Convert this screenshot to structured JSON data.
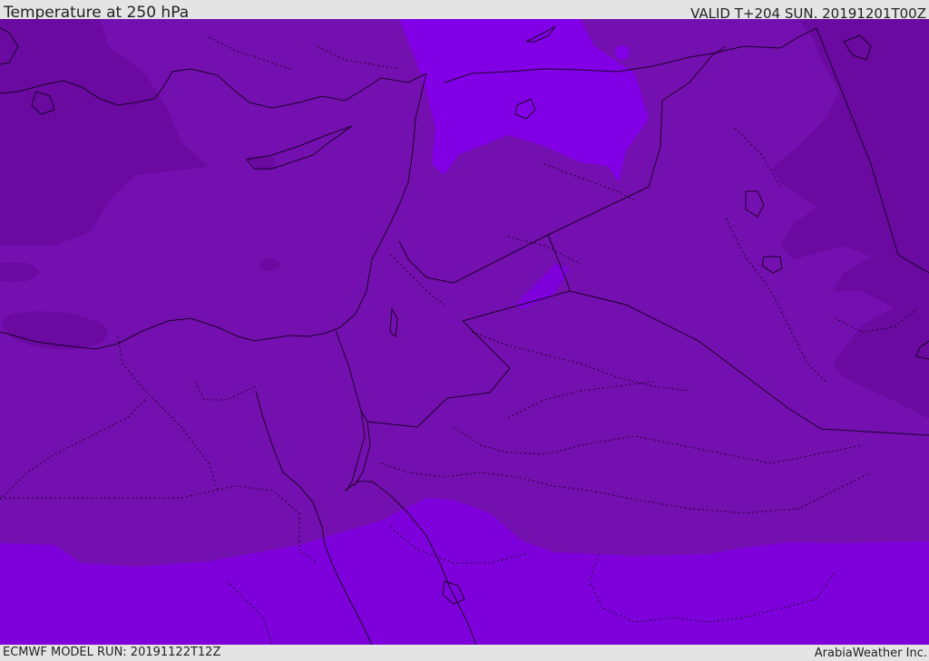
{
  "header": {
    "title": "Temperature at 250 hPa",
    "valid_time": "VALID T+204 SUN. 20191201T00Z"
  },
  "footer": {
    "model_run": "ECMWF MODEL RUN: 20191122T12Z",
    "credit": "ArabiaWeather Inc."
  },
  "map": {
    "variable": "temperature",
    "level": "250 hPa",
    "colors": {
      "base": "#7510b0",
      "cold": "#6a0aa0",
      "warm": "#7e00db",
      "warm_light": "#8200e6",
      "line": "#1a0028"
    }
  }
}
